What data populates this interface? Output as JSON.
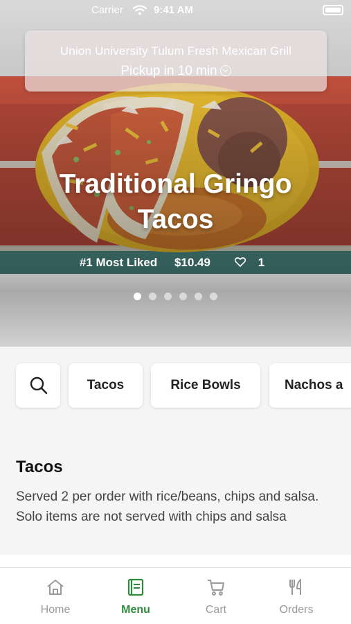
{
  "status_bar": {
    "carrier": "Carrier",
    "time": "9:41 AM"
  },
  "store": {
    "name": "Union University Tulum Fresh Mexican Grill",
    "pickup": "Pickup in 10 min"
  },
  "featured": {
    "title": "Traditional Gringo Tacos",
    "badge": "#1 Most Liked",
    "price": "$10.49",
    "likes": "1",
    "carousel": {
      "count": 6,
      "active_index": 0
    }
  },
  "categories": {
    "search_icon": "search-icon",
    "items": [
      "Tacos",
      "Rice Bowls",
      "Nachos a"
    ]
  },
  "section": {
    "title": "Tacos",
    "description": "Served 2 per order with rice/beans, chips and salsa.  Solo items are not served with chips and salsa"
  },
  "tabbar": {
    "items": [
      {
        "label": "Home",
        "icon": "home-icon",
        "active": false
      },
      {
        "label": "Menu",
        "icon": "menu-icon",
        "active": true
      },
      {
        "label": "Cart",
        "icon": "cart-icon",
        "active": false
      },
      {
        "label": "Orders",
        "icon": "fork-knife-icon",
        "active": false
      }
    ],
    "active_color": "#2e8b3e",
    "inactive_color": "#9a9a9a"
  }
}
